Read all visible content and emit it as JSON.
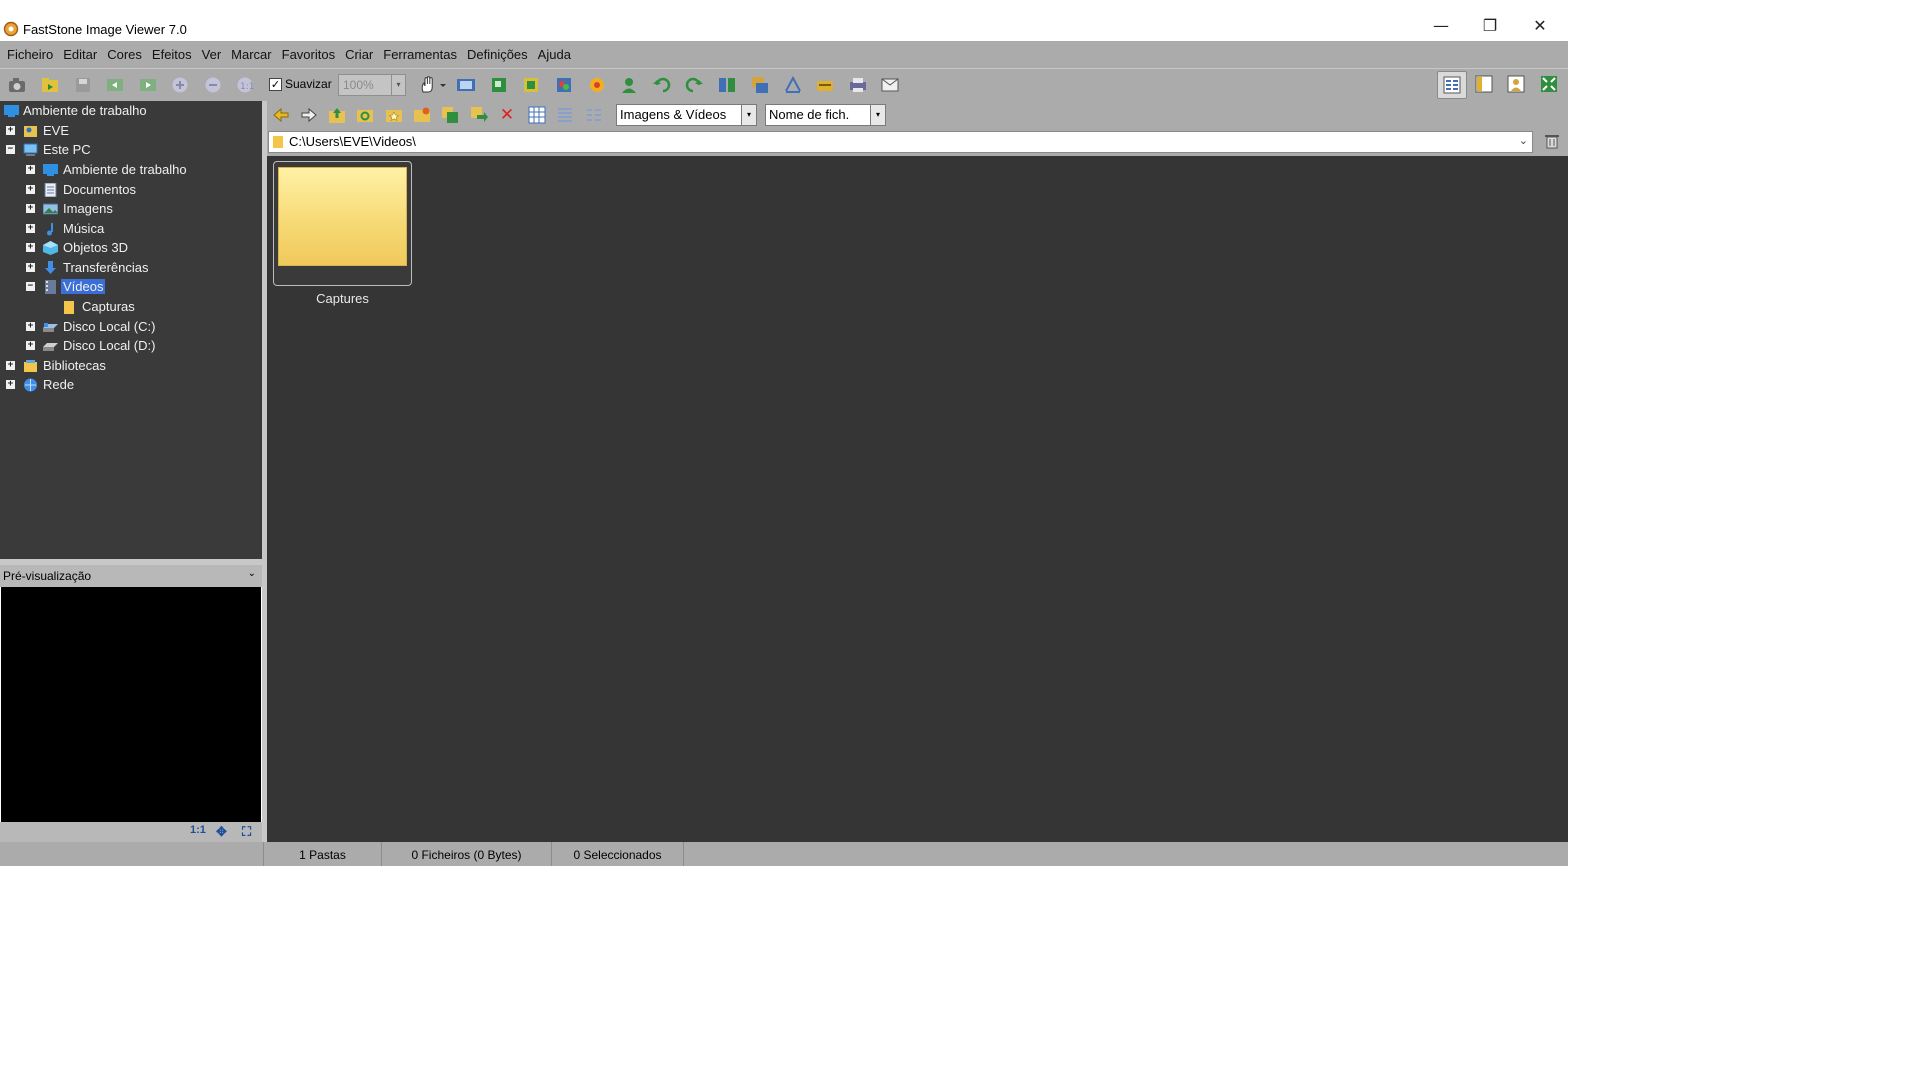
{
  "window": {
    "title": "FastStone Image Viewer 7.0",
    "minimize_glyph": "—",
    "restore_glyph": "❐",
    "close_glyph": "✕"
  },
  "menu": [
    "Ficheiro",
    "Editar",
    "Cores",
    "Efeitos",
    "Ver",
    "Marcar",
    "Favoritos",
    "Criar",
    "Ferramentas",
    "Definições",
    "Ajuda"
  ],
  "toolbar": {
    "smooth_label": "Suavizar",
    "smooth_checked_glyph": "✓",
    "zoom_value": "100%",
    "dropdown_glyph": "▾",
    "icons": [
      "acquire-camera-icon",
      "open-folder-icon",
      "save-icon",
      "previous-folder-icon",
      "next-folder-icon",
      "zoom-in-icon",
      "zoom-out-icon",
      "actual-size-icon",
      "hand-icon",
      "slideshow-icon",
      "resize-icon",
      "crop-icon",
      "color-adjust-icon",
      "red-eye-icon",
      "person-icon",
      "rotate-left-icon",
      "rotate-right-icon",
      "compare-icon",
      "batch-convert-icon",
      "draw-icon",
      "scan-icon",
      "print-icon",
      "email-icon"
    ]
  },
  "tree": {
    "expand_glyph": "+",
    "collapse_glyph": "−",
    "items": [
      {
        "label": "Ambiente de trabalho",
        "icon": "desktop-icon"
      },
      {
        "label": "EVE",
        "icon": "user-folder-icon"
      },
      {
        "label": "Este PC",
        "icon": "computer-icon"
      },
      {
        "label": "Ambiente de trabalho",
        "icon": "desktop-icon"
      },
      {
        "label": "Documentos",
        "icon": "documents-icon"
      },
      {
        "label": "Imagens",
        "icon": "pictures-icon"
      },
      {
        "label": "Música",
        "icon": "music-icon"
      },
      {
        "label": "Objetos 3D",
        "icon": "objects-3d-icon"
      },
      {
        "label": "Transferências",
        "icon": "downloads-icon"
      },
      {
        "label": "Vídeos",
        "icon": "videos-icon"
      },
      {
        "label": "Capturas",
        "icon": "folder-icon"
      },
      {
        "label": "Disco Local (C:)",
        "icon": "drive-icon"
      },
      {
        "label": "Disco Local (D:)",
        "icon": "drive-icon"
      },
      {
        "label": "Bibliotecas",
        "icon": "libraries-icon"
      },
      {
        "label": "Rede",
        "icon": "network-icon"
      }
    ]
  },
  "preview": {
    "title": "Pré-visualização",
    "collapse_glyph": "⌄",
    "btn_actual": "1:1",
    "fit_glyph": "✥",
    "full_glyph": "⛶"
  },
  "nav": {
    "filter": "Imagens & Vídeos",
    "sort": "Nome de fich.",
    "dropdown_glyph": "▾",
    "delete_glyph": "✕"
  },
  "address": {
    "path": "C:\\Users\\EVE\\Videos\\",
    "dropdown_glyph": "⌄"
  },
  "browser": {
    "items": [
      {
        "label": "Captures",
        "type": "folder"
      }
    ]
  },
  "status": {
    "folders": "1 Pastas",
    "files": "0 Ficheiros (0 Bytes)",
    "selected": "0 Seleccionados"
  },
  "colors": {
    "panel_dark": "#3a3a3a",
    "browser_bg": "#353535",
    "chrome_gray": "#ababab",
    "selection": "#3a6fd8",
    "folder_yellow": "#f6d873"
  }
}
